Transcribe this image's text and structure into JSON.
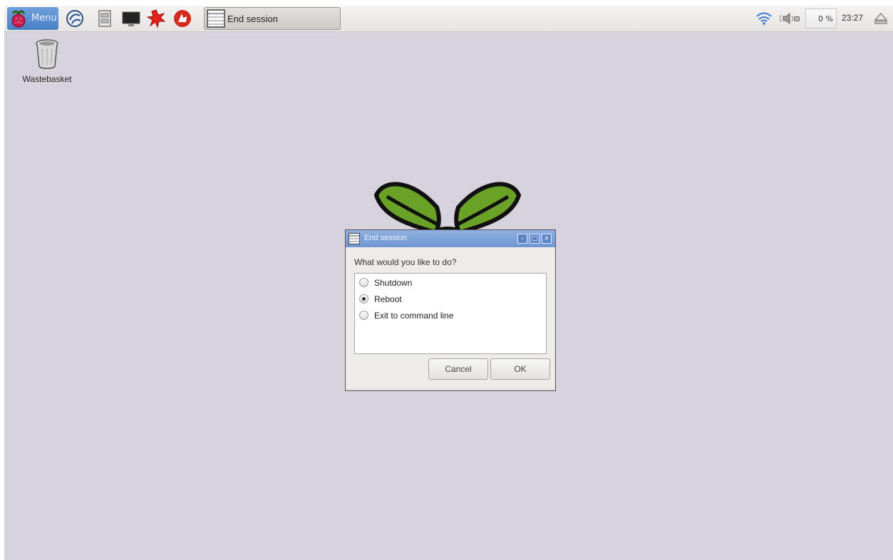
{
  "taskbar": {
    "menu_label": "Menu",
    "launchers": [
      "web-browser-icon",
      "file-manager-icon",
      "terminal-icon",
      "mathematica-icon",
      "wolfram-icon"
    ],
    "task_button_label": "End session",
    "cpu_usage": "0 %",
    "clock": "23:27",
    "tray_icons": [
      "wifi-icon",
      "volume-icon",
      "eject-icon"
    ]
  },
  "desktop": {
    "icons": [
      {
        "label": "Wastebasket",
        "icon": "wastebasket-icon"
      }
    ]
  },
  "dialog": {
    "title": "End session",
    "question": "What would you like to do?",
    "options": [
      {
        "label": "Shutdown",
        "selected": false
      },
      {
        "label": "Reboot",
        "selected": true
      },
      {
        "label": "Exit to command line",
        "selected": false
      }
    ],
    "cancel_label": "Cancel",
    "ok_label": "OK"
  },
  "colors": {
    "desktop_bg": "#d7d3de",
    "titlebar": "#7a9fd8",
    "menu_button": "#5a8dd0"
  }
}
